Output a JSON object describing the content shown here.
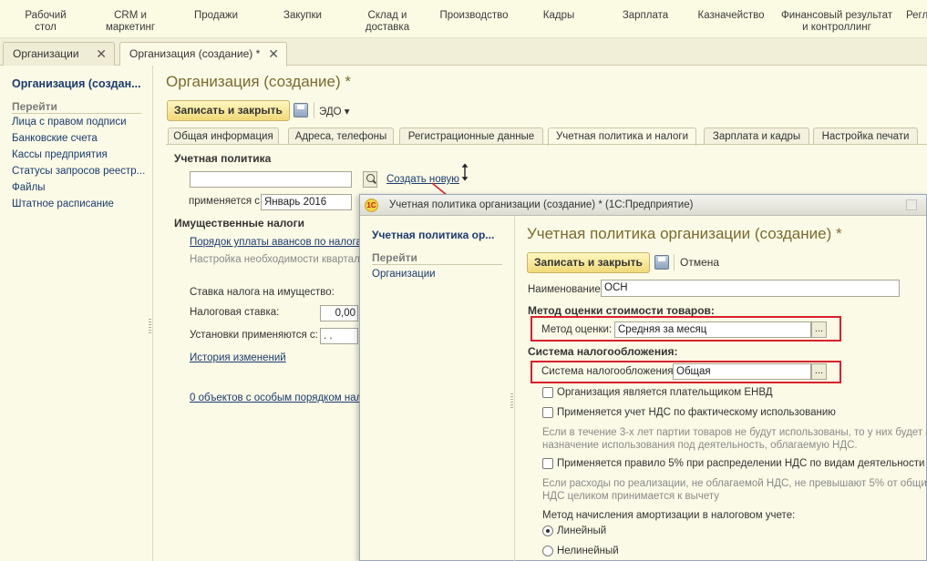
{
  "topnav": [
    "Рабочий\nстол",
    "CRM и\nмаркетинг",
    "Продажи",
    "Закупки",
    "Склад и\nдоставка",
    "Производство",
    "Кадры",
    "Зарплата",
    "Казначейство",
    "Финансовый результат\nи контроллинг",
    "Регл"
  ],
  "window_tabs": [
    {
      "label": "Организации",
      "close": "✕"
    },
    {
      "label": "Организация (создание) *",
      "close": "✕"
    }
  ],
  "left_panel": {
    "title": "Организация (создан...",
    "goto": "Перейти",
    "links": [
      "Лица с правом подписи",
      "Банковские счета",
      "Кассы предприятия",
      "Статусы запросов реестр...",
      "Файлы",
      "Штатное расписание"
    ]
  },
  "main": {
    "title": "Организация (создание) *",
    "save_close": "Записать и закрыть",
    "edo": "ЭДО ▾",
    "tabs": [
      "Общая информация",
      "Адреса, телефоны",
      "Регистрационные данные",
      "Учетная политика и налоги",
      "Зарплата и кадры",
      "Настройка печати"
    ],
    "policy_section": "Учетная политика",
    "policy_value": "",
    "create_new": "Создать новую",
    "applies_label": "применяется с:",
    "applies_value": "Январь 2016",
    "property_section": "Имущественные налоги",
    "advance_link": "Порядок уплаты авансов по налога",
    "quarter_hint": "Настройка необходимости квартал",
    "rate_label": "Ставка налога на имущество:",
    "tax_rate_label": "Налоговая ставка:",
    "tax_rate_value": "0,00",
    "settings_label": "Установки применяются с:",
    "settings_value": " .  .",
    "history_link": "История изменений",
    "objects_link": "0 объектов с особым порядком нал"
  },
  "dialog": {
    "title": "Учетная политика организации (создание) * (1С:Предприятие)",
    "logo": "1С",
    "left_title": "Учетная политика ор...",
    "left_goto": "Перейти",
    "left_link": "Организации",
    "heading": "Учетная политика организации (создание) *",
    "save_close": "Записать и закрыть",
    "cancel": "Отмена",
    "name_label": "Наименование:",
    "name_value": "ОСН",
    "valuation_section": "Метод оценки стоимости товаров:",
    "valuation_label": "Метод оценки:",
    "valuation_value": "Средняя за месяц",
    "taxation_section": "Система налогообложения:",
    "taxation_label": "Система налогообложения:",
    "taxation_value": "Общая",
    "dots": "...",
    "check_envd": "Организация является плательщиком ЕНВД",
    "check_vat_actual": "Применяется учет НДС по фактическому использованию",
    "hint_vat_actual_1": "Если в течение 3-х лет партии товаров не будут использованы, то у них будет авто",
    "hint_vat_actual_2": "назначение использования под деятельность, облагаемую НДС.",
    "check_5pct": "Применяется правило 5% при распределении НДС по видам деятельности",
    "hint_5pct_1": "Если расходы по реализации, не облагаемой НДС, не превышают 5% от общих ра",
    "hint_5pct_2": "НДС целиком принимается к вычету",
    "depr_label": "Метод начисления амортизации в налоговом учете:",
    "radio_linear": "Линейный",
    "radio_nonlinear": "Нелинейный"
  },
  "colors": {
    "background": "#fbfae6",
    "link": "#1b3b6f",
    "title": "#7a6a2e",
    "highlight_box": "#d8202a",
    "arrow": "#d8202a"
  }
}
